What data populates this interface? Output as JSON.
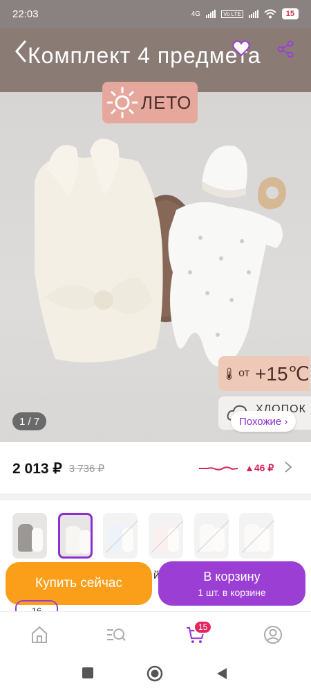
{
  "status_bar": {
    "time": "22:03",
    "network": "4G",
    "lte_label": "Vo LTE",
    "battery": "15"
  },
  "product": {
    "title": "Комплект 4 предмета",
    "season_label": "ЛЕТО",
    "temp_prefix": "от",
    "temp_value": "+15℃",
    "material_label": "ХЛОПОК",
    "image_counter": "1 / 7",
    "similar_label": "Похожие ›"
  },
  "price": {
    "current": "2 013 ₽",
    "old": "3 736 ₽",
    "delta": "▲46 ₽",
    "accent_color": "#d6245a"
  },
  "variants": [
    {
      "selected": false,
      "available": true
    },
    {
      "selected": true,
      "available": true
    },
    {
      "selected": false,
      "available": false
    },
    {
      "selected": false,
      "available": false
    },
    {
      "selected": false,
      "available": false
    },
    {
      "selected": false,
      "available": false
    }
  ],
  "actions": {
    "buy_now": "Купить сейчас",
    "add_to_cart": "В корзину",
    "cart_note": "1 шт. в корзине",
    "peek_text": "й,",
    "peek_badge": "16"
  },
  "bottom_nav": {
    "items": [
      {
        "icon": "home-icon"
      },
      {
        "icon": "catalog-search-icon"
      },
      {
        "icon": "cart-icon",
        "badge": "15"
      },
      {
        "icon": "profile-icon"
      }
    ]
  },
  "colors": {
    "brand_purple": "#9b3fd4",
    "buy_orange": "#fb9f1a",
    "banner_brown": "#8a7c75"
  }
}
